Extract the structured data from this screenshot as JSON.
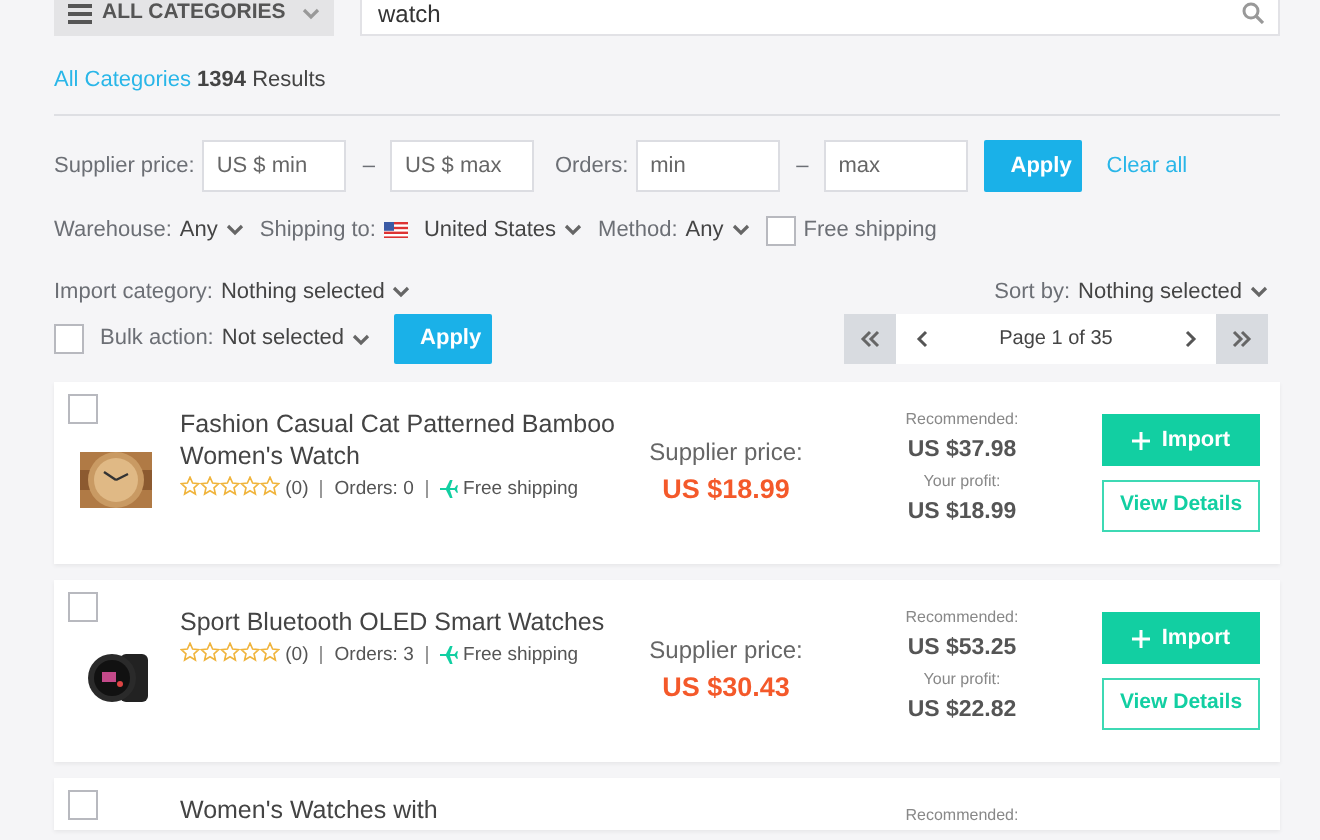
{
  "category_dropdown": {
    "label": "ALL CATEGORIES"
  },
  "search": {
    "value": "watch"
  },
  "results": {
    "category_link": "All Categories",
    "count": "1394",
    "suffix": "Results"
  },
  "ranges": [
    {
      "label": "Supplier price:",
      "min_placeholder": "US $ min",
      "separator": "–",
      "max_placeholder": "US $ max"
    },
    {
      "label": "Orders:",
      "min_placeholder": "min",
      "separator": "–",
      "max_placeholder": "max"
    }
  ],
  "filter_apply": "Apply",
  "clear_all": "Clear all",
  "options": [
    {
      "label": "Warehouse:",
      "value": "Any",
      "flag": false
    },
    {
      "label": "Shipping to:",
      "value": "United States",
      "flag": true
    },
    {
      "label": "Method:",
      "value": "Any",
      "flag": false
    }
  ],
  "free_shipping": {
    "label": "Free shipping",
    "checked": false
  },
  "import_category": {
    "label": "Import category:",
    "value": "Nothing selected"
  },
  "sort_by": {
    "label": "Sort by:",
    "value": "Nothing selected"
  },
  "bulk": {
    "checked": false,
    "label": "Bulk action:",
    "value": "Not selected",
    "apply": "Apply"
  },
  "pagination": {
    "text": "Page 1 of 35"
  },
  "products": [
    {
      "checked": false,
      "title": "Fashion Casual Cat Patterned Bamboo Women's Watch",
      "stars": 0,
      "rating_count": "(0)",
      "orders": "Orders: 0",
      "shipping": "Free shipping",
      "price_label": "Supplier price:",
      "price": "US $18.99",
      "recommended_label": "Recommended:",
      "recommended": "US $37.98",
      "profit_label": "Your profit:",
      "profit": "US $18.99",
      "import_label": "Import",
      "details_label": "View Details"
    },
    {
      "checked": false,
      "title": "Sport Bluetooth OLED Smart Watches",
      "stars": 0,
      "rating_count": "(0)",
      "orders": "Orders: 3",
      "shipping": "Free shipping",
      "price_label": "Supplier price:",
      "price": "US $30.43",
      "recommended_label": "Recommended:",
      "recommended": "US $53.25",
      "profit_label": "Your profit:",
      "profit": "US $22.82",
      "import_label": "Import",
      "details_label": "View Details"
    },
    {
      "checked": false,
      "title": "Women's Watches with",
      "recommended_label": "Recommended:"
    }
  ]
}
